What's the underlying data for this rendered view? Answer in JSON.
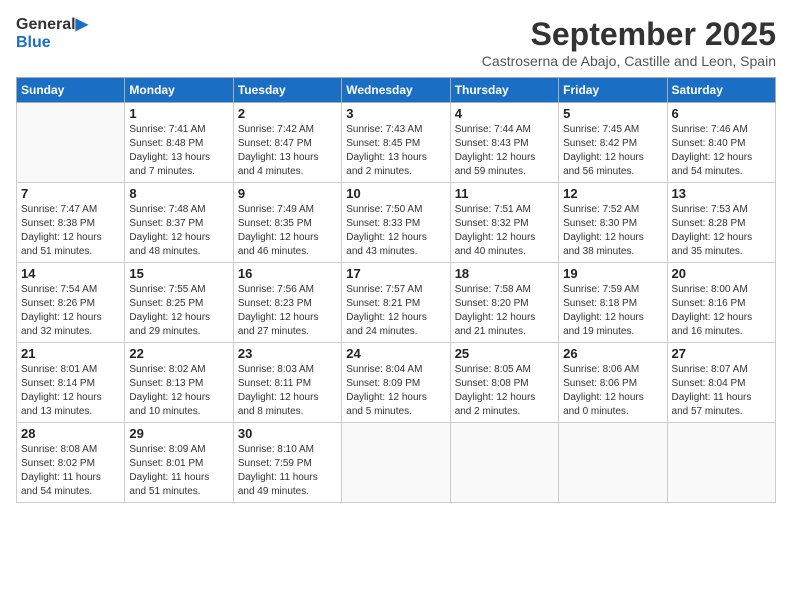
{
  "header": {
    "logo_general": "General",
    "logo_blue": "Blue",
    "month_title": "September 2025",
    "location": "Castroserna de Abajo, Castille and Leon, Spain"
  },
  "days_of_week": [
    "Sunday",
    "Monday",
    "Tuesday",
    "Wednesday",
    "Thursday",
    "Friday",
    "Saturday"
  ],
  "weeks": [
    [
      {
        "day": "",
        "info": ""
      },
      {
        "day": "1",
        "info": "Sunrise: 7:41 AM\nSunset: 8:48 PM\nDaylight: 13 hours\nand 7 minutes."
      },
      {
        "day": "2",
        "info": "Sunrise: 7:42 AM\nSunset: 8:47 PM\nDaylight: 13 hours\nand 4 minutes."
      },
      {
        "day": "3",
        "info": "Sunrise: 7:43 AM\nSunset: 8:45 PM\nDaylight: 13 hours\nand 2 minutes."
      },
      {
        "day": "4",
        "info": "Sunrise: 7:44 AM\nSunset: 8:43 PM\nDaylight: 12 hours\nand 59 minutes."
      },
      {
        "day": "5",
        "info": "Sunrise: 7:45 AM\nSunset: 8:42 PM\nDaylight: 12 hours\nand 56 minutes."
      },
      {
        "day": "6",
        "info": "Sunrise: 7:46 AM\nSunset: 8:40 PM\nDaylight: 12 hours\nand 54 minutes."
      }
    ],
    [
      {
        "day": "7",
        "info": "Sunrise: 7:47 AM\nSunset: 8:38 PM\nDaylight: 12 hours\nand 51 minutes."
      },
      {
        "day": "8",
        "info": "Sunrise: 7:48 AM\nSunset: 8:37 PM\nDaylight: 12 hours\nand 48 minutes."
      },
      {
        "day": "9",
        "info": "Sunrise: 7:49 AM\nSunset: 8:35 PM\nDaylight: 12 hours\nand 46 minutes."
      },
      {
        "day": "10",
        "info": "Sunrise: 7:50 AM\nSunset: 8:33 PM\nDaylight: 12 hours\nand 43 minutes."
      },
      {
        "day": "11",
        "info": "Sunrise: 7:51 AM\nSunset: 8:32 PM\nDaylight: 12 hours\nand 40 minutes."
      },
      {
        "day": "12",
        "info": "Sunrise: 7:52 AM\nSunset: 8:30 PM\nDaylight: 12 hours\nand 38 minutes."
      },
      {
        "day": "13",
        "info": "Sunrise: 7:53 AM\nSunset: 8:28 PM\nDaylight: 12 hours\nand 35 minutes."
      }
    ],
    [
      {
        "day": "14",
        "info": "Sunrise: 7:54 AM\nSunset: 8:26 PM\nDaylight: 12 hours\nand 32 minutes."
      },
      {
        "day": "15",
        "info": "Sunrise: 7:55 AM\nSunset: 8:25 PM\nDaylight: 12 hours\nand 29 minutes."
      },
      {
        "day": "16",
        "info": "Sunrise: 7:56 AM\nSunset: 8:23 PM\nDaylight: 12 hours\nand 27 minutes."
      },
      {
        "day": "17",
        "info": "Sunrise: 7:57 AM\nSunset: 8:21 PM\nDaylight: 12 hours\nand 24 minutes."
      },
      {
        "day": "18",
        "info": "Sunrise: 7:58 AM\nSunset: 8:20 PM\nDaylight: 12 hours\nand 21 minutes."
      },
      {
        "day": "19",
        "info": "Sunrise: 7:59 AM\nSunset: 8:18 PM\nDaylight: 12 hours\nand 19 minutes."
      },
      {
        "day": "20",
        "info": "Sunrise: 8:00 AM\nSunset: 8:16 PM\nDaylight: 12 hours\nand 16 minutes."
      }
    ],
    [
      {
        "day": "21",
        "info": "Sunrise: 8:01 AM\nSunset: 8:14 PM\nDaylight: 12 hours\nand 13 minutes."
      },
      {
        "day": "22",
        "info": "Sunrise: 8:02 AM\nSunset: 8:13 PM\nDaylight: 12 hours\nand 10 minutes."
      },
      {
        "day": "23",
        "info": "Sunrise: 8:03 AM\nSunset: 8:11 PM\nDaylight: 12 hours\nand 8 minutes."
      },
      {
        "day": "24",
        "info": "Sunrise: 8:04 AM\nSunset: 8:09 PM\nDaylight: 12 hours\nand 5 minutes."
      },
      {
        "day": "25",
        "info": "Sunrise: 8:05 AM\nSunset: 8:08 PM\nDaylight: 12 hours\nand 2 minutes."
      },
      {
        "day": "26",
        "info": "Sunrise: 8:06 AM\nSunset: 8:06 PM\nDaylight: 12 hours\nand 0 minutes."
      },
      {
        "day": "27",
        "info": "Sunrise: 8:07 AM\nSunset: 8:04 PM\nDaylight: 11 hours\nand 57 minutes."
      }
    ],
    [
      {
        "day": "28",
        "info": "Sunrise: 8:08 AM\nSunset: 8:02 PM\nDaylight: 11 hours\nand 54 minutes."
      },
      {
        "day": "29",
        "info": "Sunrise: 8:09 AM\nSunset: 8:01 PM\nDaylight: 11 hours\nand 51 minutes."
      },
      {
        "day": "30",
        "info": "Sunrise: 8:10 AM\nSunset: 7:59 PM\nDaylight: 11 hours\nand 49 minutes."
      },
      {
        "day": "",
        "info": ""
      },
      {
        "day": "",
        "info": ""
      },
      {
        "day": "",
        "info": ""
      },
      {
        "day": "",
        "info": ""
      }
    ]
  ]
}
